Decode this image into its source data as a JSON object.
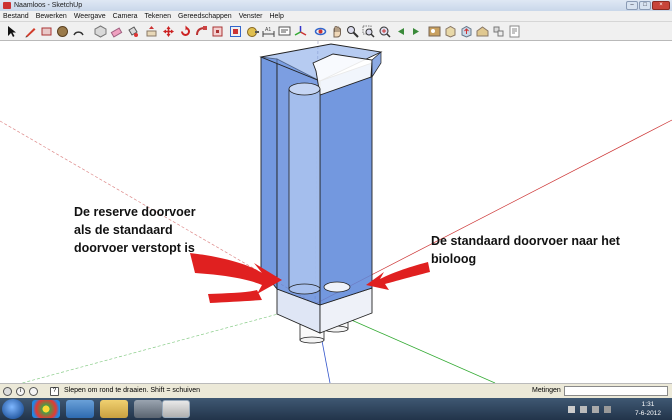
{
  "window": {
    "title": "Naamloos - SketchUp",
    "controls": [
      "–",
      "□",
      "×"
    ]
  },
  "menu": [
    "Bestand",
    "Bewerken",
    "Weergave",
    "Camera",
    "Tekenen",
    "Gereedschappen",
    "Venster",
    "Help"
  ],
  "toolbar": {
    "icons": [
      "select-arrow-icon",
      "pencil-icon",
      "rectangle-icon",
      "circle-icon",
      "arc-icon",
      "make-component-icon",
      "eraser-icon",
      "paint-bucket-icon",
      "push-pull-icon",
      "move-icon",
      "rotate-icon",
      "follow-me-icon",
      "scale-icon",
      "offset-icon",
      "tape-measure-icon",
      "dimension-icon",
      "text-icon",
      "axes-icon",
      "orbit-icon",
      "pan-icon",
      "zoom-icon",
      "zoom-window-icon",
      "zoom-extents-icon",
      "previous-view-icon",
      "next-view-icon",
      "photo-texture-icon",
      "get-models-icon",
      "share-model-icon",
      "warehouse-icon",
      "components-icon",
      "layout-icon"
    ]
  },
  "annotations": {
    "reserve": "De reserve doorvoer\nals de standaard\ndoorvoer verstopt is",
    "standard": "De standaard doorvoer naar het\nbioloog"
  },
  "colors": {
    "box_fill": "#5b86d9",
    "arrow": "#e02020",
    "axis_red": "#cc3333",
    "axis_green": "#33aa33",
    "axis_blue": "#3355cc"
  },
  "statusbar": {
    "text": "Slepen om rond te draaien. Shift = schuiven",
    "measurements_label": "Metingen",
    "measurements_value": ""
  },
  "taskbar": {
    "apps": [
      "chrome-icon",
      "explorer-apps-icon",
      "file-explorer-icon",
      "media-icon",
      "sketchup-icon"
    ],
    "time": "1:31",
    "date": "7-6-2012"
  }
}
